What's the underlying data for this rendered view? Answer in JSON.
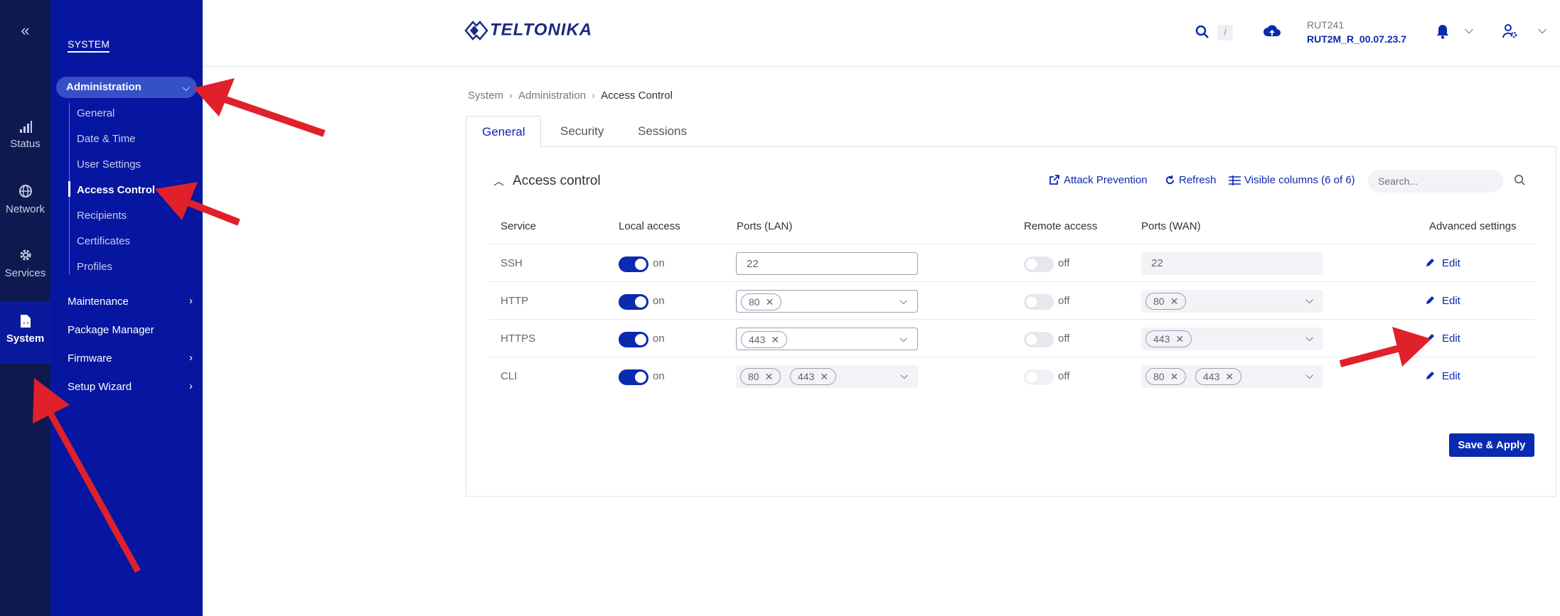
{
  "rail": {
    "collapse_glyph": "«",
    "items": [
      {
        "label": "Status",
        "icon": "signal-icon"
      },
      {
        "label": "Network",
        "icon": "globe-icon"
      },
      {
        "label": "Services",
        "icon": "gear-icon"
      },
      {
        "label": "System",
        "icon": "system-icon",
        "active": true
      }
    ]
  },
  "sidebar": {
    "section": "SYSTEM",
    "active_group": "Administration",
    "sub_items": [
      "General",
      "Date & Time",
      "User Settings",
      "Access Control",
      "Recipients",
      "Certificates",
      "Profiles"
    ],
    "active_sub_item": "Access Control",
    "nav": [
      "Maintenance",
      "Package Manager",
      "Firmware",
      "Setup Wizard"
    ]
  },
  "header": {
    "logo_text": "TELTONIKA",
    "search_shortcut": "/",
    "device_model": "RUT241",
    "firmware": "RUT2M_R_00.07.23.7"
  },
  "breadcrumb": [
    "System",
    "Administration",
    "Access Control"
  ],
  "tabs": [
    "General",
    "Security",
    "Sessions"
  ],
  "active_tab": "General",
  "card": {
    "title": "Access control",
    "attack_prevention": "Attack Prevention",
    "refresh": "Refresh",
    "visible_columns": "Visible columns (6 of 6)",
    "search_placeholder": "Search..."
  },
  "table": {
    "columns": [
      "Service",
      "Local access",
      "Ports (LAN)",
      "Remote access",
      "Ports (WAN)",
      "Advanced settings"
    ],
    "rows": [
      {
        "service": "SSH",
        "local": "on",
        "lan": "22",
        "remote": "off",
        "wan": "22",
        "edit": "Edit"
      },
      {
        "service": "HTTP",
        "local": "on",
        "lan_chips": [
          "80"
        ],
        "remote": "off",
        "wan_chips": [
          "80"
        ],
        "edit": "Edit"
      },
      {
        "service": "HTTPS",
        "local": "on",
        "lan_chips": [
          "443"
        ],
        "remote": "off",
        "wan_chips": [
          "443"
        ],
        "edit": "Edit"
      },
      {
        "service": "CLI",
        "local": "on",
        "lan_chips": [
          "80",
          "443"
        ],
        "remote": "off",
        "wan_chips": [
          "80",
          "443"
        ],
        "edit": "Edit"
      }
    ]
  },
  "save_label": "Save & Apply",
  "colors": {
    "brand": "#0a2ab0",
    "sidebar": "#0716a0",
    "rail": "#0e1a4f",
    "arrow": "#e0202a"
  }
}
